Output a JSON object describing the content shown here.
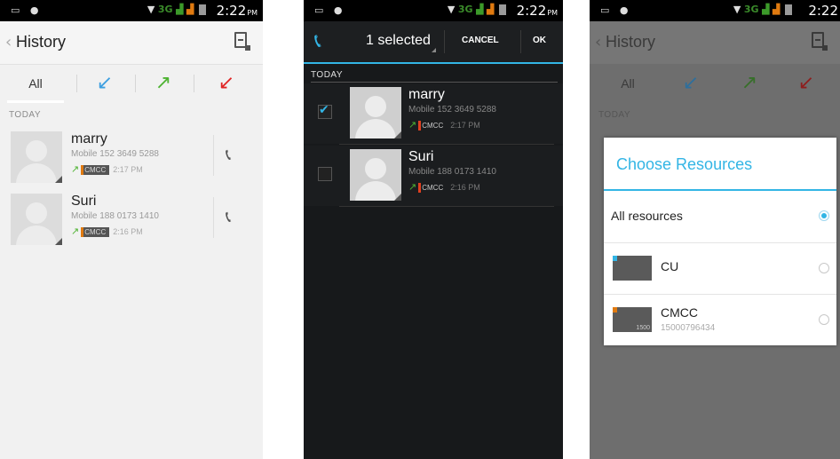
{
  "status_bar": {
    "time": "2:22",
    "ampm": "PM",
    "network": "3G"
  },
  "history": {
    "title": "History",
    "filters": {
      "all_label": "All"
    },
    "section": "TODAY",
    "calls": [
      {
        "name": "marry",
        "number": "Mobile 152 3649 5288",
        "sim": "CMCC",
        "time": "2:17 PM"
      },
      {
        "name": "Suri",
        "number": "Mobile 188 0173 1410",
        "sim": "CMCC",
        "time": "2:16 PM"
      }
    ]
  },
  "selection": {
    "count_label": "1 selected",
    "cancel_label": "CANCEL",
    "ok_label": "OK",
    "section": "TODAY",
    "calls": [
      {
        "name": "marry",
        "number": "Mobile 152 3649 5288",
        "sim": "CMCC",
        "time": "2:17 PM",
        "checked": true
      },
      {
        "name": "Suri",
        "number": "Mobile 188 0173 1410",
        "sim": "CMCC",
        "time": "2:16 PM",
        "checked": false
      }
    ]
  },
  "dialog": {
    "title": "Choose Resources",
    "options": [
      {
        "label": "All resources",
        "selected": true
      },
      {
        "label": "CU",
        "selected": false
      },
      {
        "label": "CMCC",
        "sub": "15000796434",
        "card_number": "1500",
        "selected": false
      }
    ]
  },
  "colors": {
    "accent": "#33b5e5",
    "incoming": "#3d9fe0",
    "outgoing": "#4eb332",
    "missed": "#e02525",
    "sim_cmcc": "#e07a10"
  }
}
